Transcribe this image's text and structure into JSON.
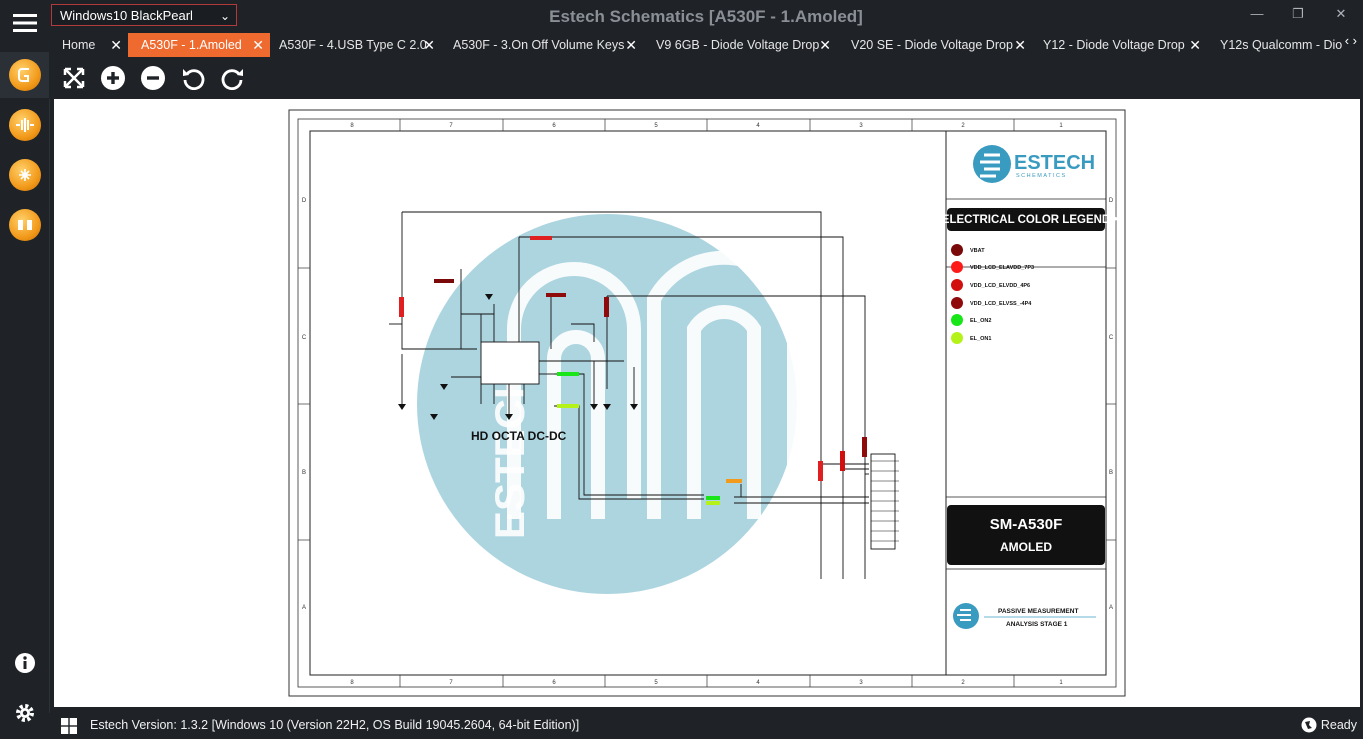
{
  "window": {
    "title": "Estech Schematics [A530F - 1.Amoled]",
    "theme_select_value": "Windows10 BlackPearl"
  },
  "tabs": [
    {
      "label": "Home"
    },
    {
      "label": "A530F - 1.Amoled",
      "active": true
    },
    {
      "label": "A530F - 4.USB Type C 2.0"
    },
    {
      "label": "A530F - 3.On Off Volume Keys"
    },
    {
      "label": "V9 6GB - Diode Voltage Drop"
    },
    {
      "label": "V20 SE - Diode Voltage Drop"
    },
    {
      "label": "Y12 - Diode Voltage Drop"
    },
    {
      "label": "Y12s Qualcomm - Dio"
    }
  ],
  "toolbar": {
    "icons": [
      "fit-screen-icon",
      "zoom-in-icon",
      "zoom-out-icon",
      "rotate-left-icon",
      "rotate-right-icon"
    ]
  },
  "sidebar": {
    "icons": [
      "menu-icon",
      "schematic-icon",
      "components-icon",
      "circuit-icon",
      "tools-icon",
      "info-icon",
      "settings-icon"
    ]
  },
  "schematic": {
    "circuit_label": "HD OCTA DC-DC",
    "grid_columns": [
      "8",
      "7",
      "6",
      "5",
      "4",
      "3",
      "2",
      "1"
    ],
    "grid_rows": [
      "D",
      "C",
      "B",
      "A"
    ],
    "brand_name": "ESTECH",
    "brand_sub": "SCHEMATICS",
    "legend_title": "• ELECTRICAL COLOR LEGEND •",
    "legend": [
      {
        "label": "VBAT",
        "color": "#7a0a0a"
      },
      {
        "label": "VDD_LCD_ELAVDD_7P3",
        "color": "#ff1a1a"
      },
      {
        "label": "VDD_LCD_ELVDD_4P6",
        "color": "#d10f0f"
      },
      {
        "label": "VDD_LCD_ELVSS_-4P4",
        "color": "#8f0b0b"
      },
      {
        "label": "EL_ON2",
        "color": "#19e619"
      },
      {
        "label": "EL_ON1",
        "color": "#b5f21a"
      }
    ],
    "model": "SM-A530F",
    "model_sub": "AMOLED",
    "footer_line1": "PASSIVE MEASUREMENT",
    "footer_line2": "ANALYSIS STAGE 1"
  },
  "status": {
    "version_text": "Estech Version: 1.3.2 [Windows 10 (Version 22H2, OS Build 19045.2604, 64-bit Edition)]",
    "ready_text": "Ready"
  },
  "colors": {
    "accent": "#ef6a2f",
    "background": "#1f2328",
    "watermark": "#a9d3df"
  }
}
